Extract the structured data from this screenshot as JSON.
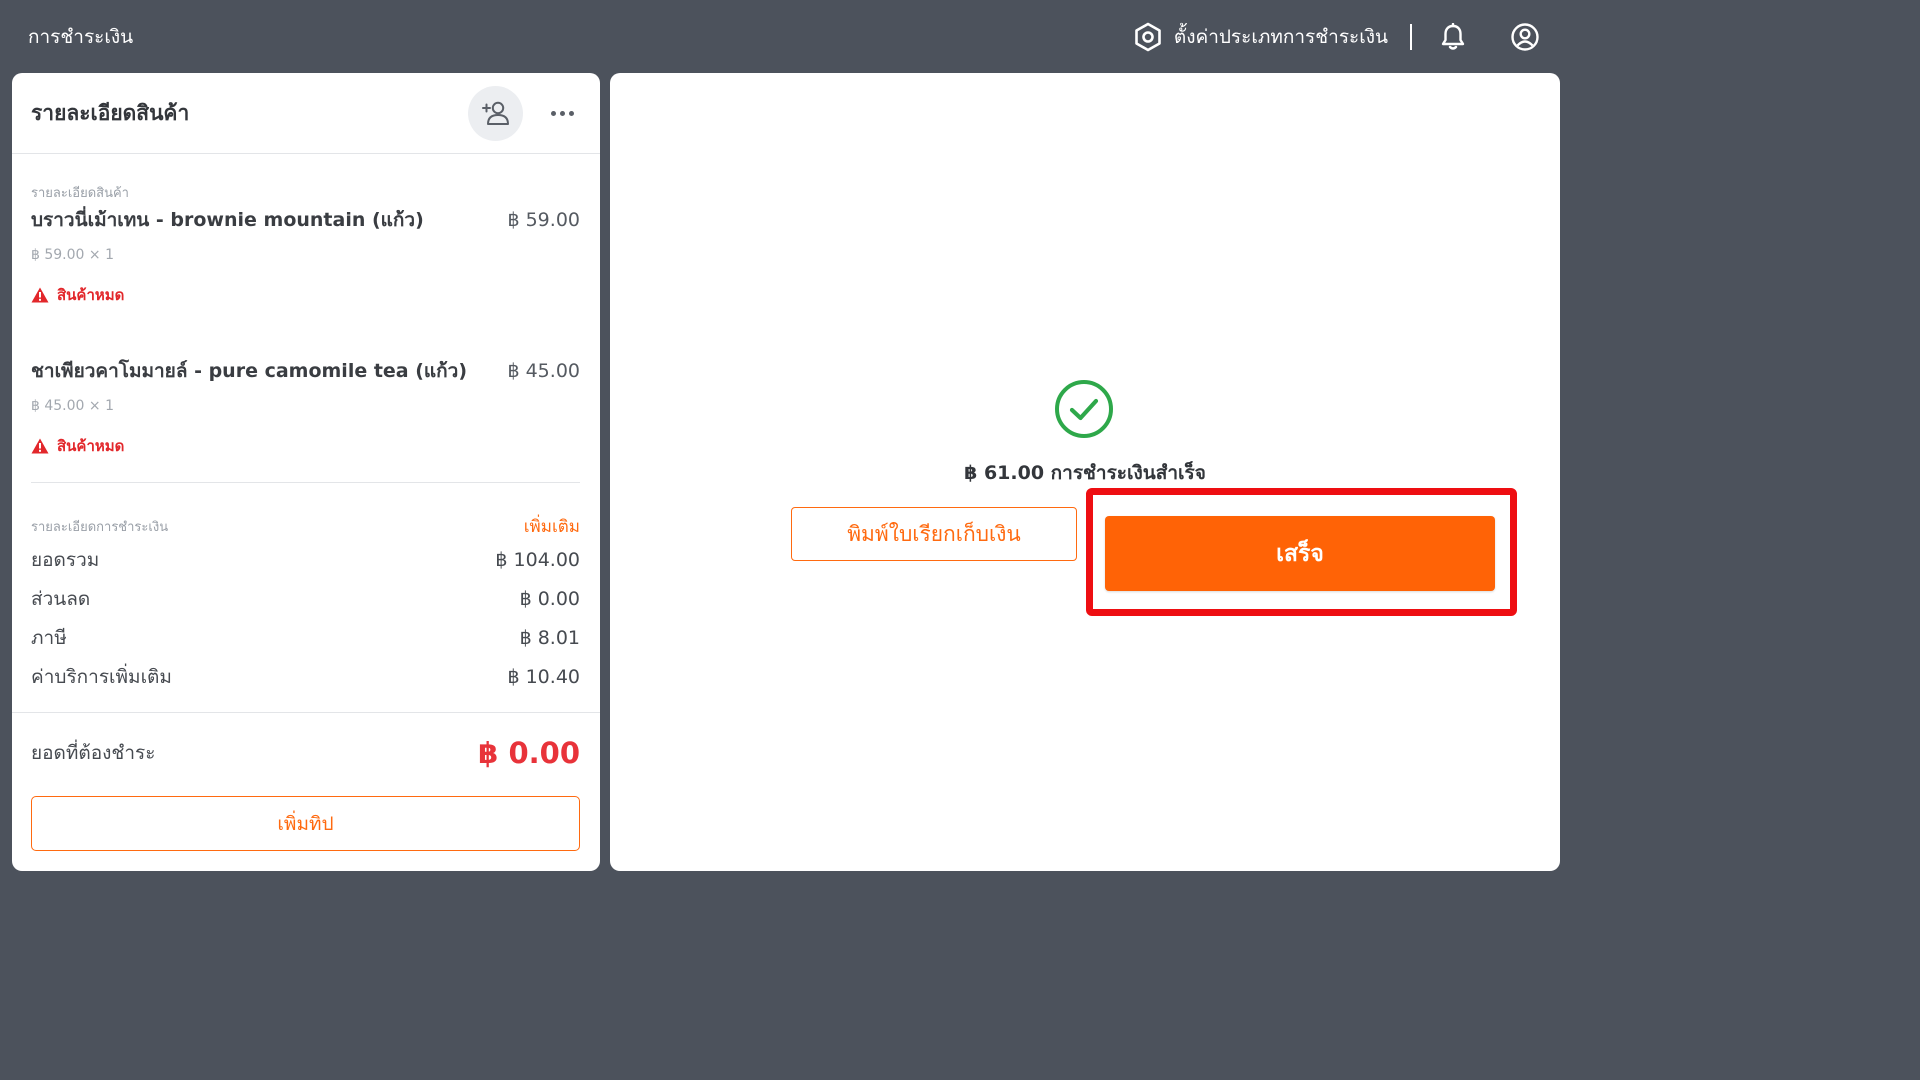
{
  "topbar": {
    "title": "การชำระเงิน",
    "settings_label": "ตั้งค่าประเภทการชำระเงิน"
  },
  "order_panel": {
    "title": "รายละเอียดสินค้า",
    "items_section_label": "รายละเอียดสินค้า",
    "items": [
      {
        "name": "บราวนี่เม้าเทน - brownie mountain (แก้ว)",
        "price": "฿ 59.00",
        "qty": "฿ 59.00 × 1",
        "warning": "สินค้าหมด"
      },
      {
        "name": "ชาเพียวคาโมมายล์ - pure camomile tea (แก้ว)",
        "price": "฿ 45.00",
        "qty": "฿ 45.00 × 1",
        "warning": "สินค้าหมด"
      }
    ],
    "payment_section_label": "รายละเอียดการชำระเงิน",
    "add_more_label": "เพิ่มเติม",
    "summary": [
      {
        "label": "ยอดรวม",
        "value": "฿ 104.00"
      },
      {
        "label": "ส่วนลด",
        "value": "฿ 0.00"
      },
      {
        "label": "ภาษี",
        "value": "฿ 8.01"
      },
      {
        "label": "ค่าบริการเพิ่มเติม",
        "value": "฿ 10.40"
      }
    ],
    "amount_due_label": "ยอดที่ต้องชำระ",
    "amount_due_value": "฿ 0.00",
    "tip_button_label": "เพิ่มทิป"
  },
  "result_panel": {
    "success_text": "฿ 61.00 การชำระเงินสำเร็จ",
    "print_button_label": "พิมพ์ใบเรียกเก็บเงิน",
    "done_button_label": "เสร็จ"
  },
  "colors": {
    "background": "#4c525c",
    "accent": "#ff6306",
    "danger": "#e8333a",
    "success": "#2ea84a",
    "highlight": "#ee0e12"
  },
  "icons": [
    "settings-hex-icon",
    "bell-icon",
    "user-circle-icon",
    "add-customer-icon",
    "more-icon",
    "warning-icon",
    "check-circle-icon"
  ]
}
